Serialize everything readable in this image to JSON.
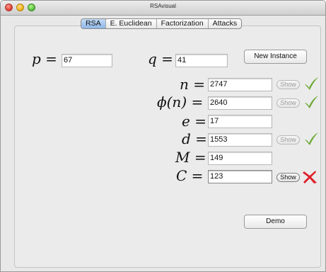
{
  "window": {
    "title": "RSAvisual"
  },
  "tabs": [
    {
      "label": "RSA",
      "active": true
    },
    {
      "label": "E. Euclidean",
      "active": false
    },
    {
      "label": "Factorization",
      "active": false
    },
    {
      "label": "Attacks",
      "active": false
    }
  ],
  "inputs": {
    "p": {
      "symbol": "p",
      "value": "67"
    },
    "q": {
      "symbol": "q",
      "value": "41"
    }
  },
  "new_instance_label": "New Instance",
  "rows": {
    "n": {
      "value": "2747",
      "show_label": "Show",
      "status": "correct"
    },
    "phi": {
      "value": "2640",
      "show_label": "Show",
      "status": "correct"
    },
    "e": {
      "value": "17"
    },
    "d": {
      "value": "1553",
      "show_label": "Show",
      "status": "correct"
    },
    "M": {
      "value": "149"
    },
    "C": {
      "value": "123",
      "show_label": "Show",
      "status": "incorrect"
    }
  },
  "demo_label": "Demo",
  "colors": {
    "check": "#6aa832",
    "cross": "#e0202a",
    "tab_active": "#9fc2ec"
  }
}
